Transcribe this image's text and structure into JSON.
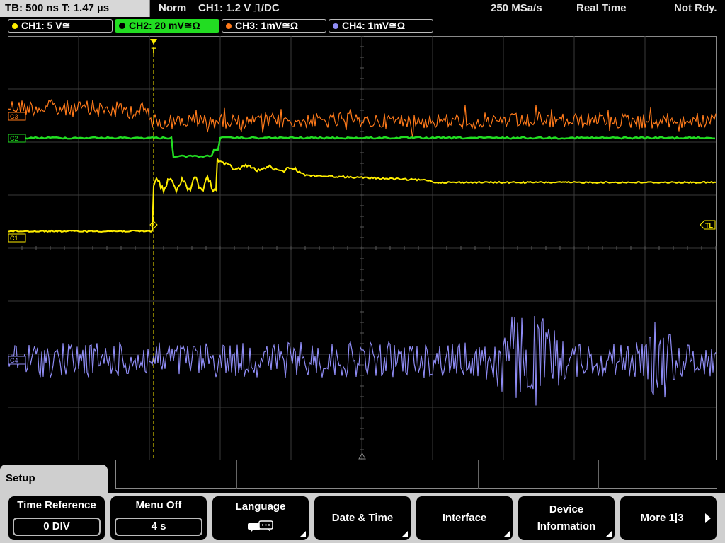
{
  "topbar": {
    "timebase": "TB: 500 ns   T: 1.47 µs",
    "mode": "Norm",
    "trigger": "CH1: 1.2 V ⎍/DC",
    "sample_rate": "250 MSa/s",
    "acq_mode": "Real Time",
    "status": "Not Rdy."
  },
  "channels": [
    {
      "label": "CH1: 5 V≅",
      "color": "#ffee00"
    },
    {
      "label": "CH2: 20 mV≅Ω",
      "color": "#22dd22"
    },
    {
      "label": "CH3: 1mV≅Ω",
      "color": "#ff7a1a"
    },
    {
      "label": "CH4: 1mV≅Ω",
      "color": "#8f8cf5"
    }
  ],
  "markers": {
    "c1": "C1",
    "c2": "C2",
    "c3": "C3",
    "c4": "C4",
    "trigger_level": "TL",
    "trigger_pos": "T"
  },
  "menu": {
    "title": "Setup",
    "softkeys": [
      {
        "label": "Time Reference",
        "value": "0 DIV"
      },
      {
        "label": "Menu Off",
        "value": "4 s"
      },
      {
        "label": "Language",
        "icon": "language-icon"
      },
      {
        "label": "Date & Time"
      },
      {
        "label": "Interface"
      },
      {
        "label_line1": "Device",
        "label_line2": "Information"
      },
      {
        "label": "More 1|3"
      }
    ]
  }
}
